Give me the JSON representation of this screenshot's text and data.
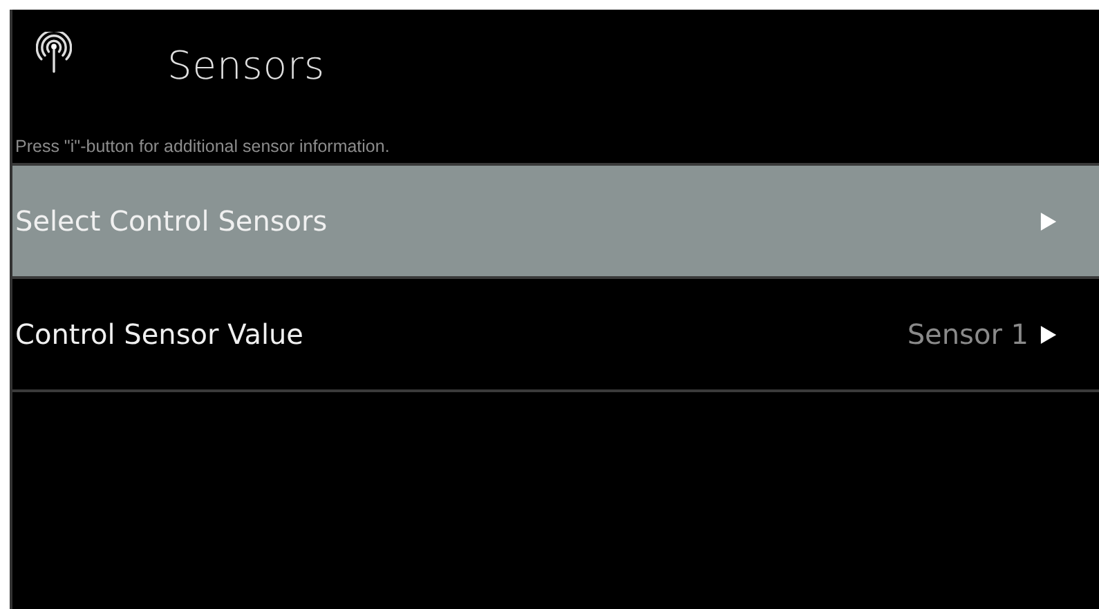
{
  "header": {
    "title": "Sensors"
  },
  "hint": "Press \"i\"-button for additional sensor information.",
  "menu_items": [
    {
      "label": "Select Control Sensors",
      "selected": true
    },
    {
      "label": "Control Sensor Value",
      "value": "Sensor 1",
      "selected": false
    }
  ]
}
